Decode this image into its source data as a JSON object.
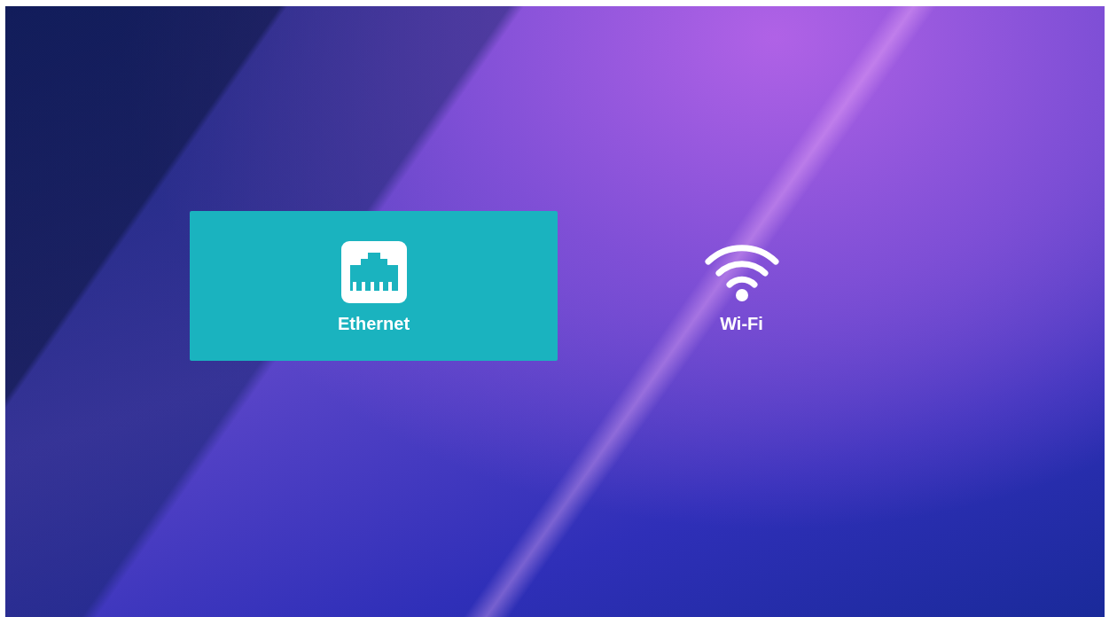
{
  "options": [
    {
      "label": "Ethernet",
      "kind": "ethernet",
      "selected": true
    },
    {
      "label": "Wi-Fi",
      "kind": "wifi",
      "selected": false
    }
  ]
}
